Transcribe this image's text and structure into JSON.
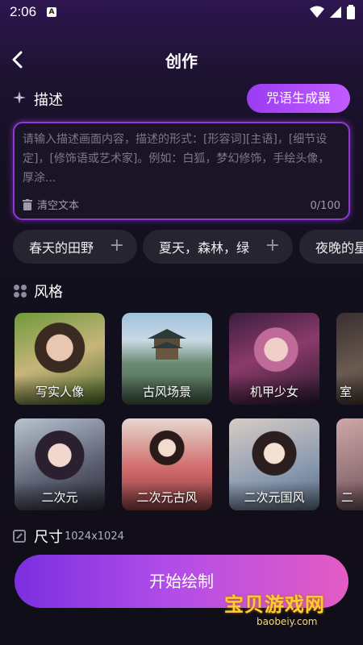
{
  "status": {
    "time": "2:06"
  },
  "header": {
    "title": "创作"
  },
  "describe": {
    "label": "描述",
    "spell_button": "咒语生成器",
    "placeholder": "请输入描述画面内容，描述的形式：[形容词][主语]，[细节设定]，[修饰语或艺术家]。例如：白狐，梦幻修饰，手绘头像，厚涂...",
    "clear_label": "清空文本",
    "counter": "0/100"
  },
  "chips": [
    {
      "label": "春天的田野"
    },
    {
      "label": "夏天，森林，绿"
    },
    {
      "label": "夜晚的星"
    }
  ],
  "style_section": {
    "label": "风格",
    "items": [
      {
        "label": "写实人像"
      },
      {
        "label": "古风场景"
      },
      {
        "label": "机甲少女"
      },
      {
        "label": "室"
      },
      {
        "label": "二次元"
      },
      {
        "label": "二次元古风"
      },
      {
        "label": "二次元国风"
      },
      {
        "label": "二"
      }
    ]
  },
  "size": {
    "label": "尺寸",
    "value": "1024x1024"
  },
  "start_button": "开始绘制",
  "watermark": {
    "text": "宝贝游戏网",
    "url": "baobeiy.com"
  },
  "colors": {
    "accent": "#9b3cf2",
    "background": "#141020"
  }
}
